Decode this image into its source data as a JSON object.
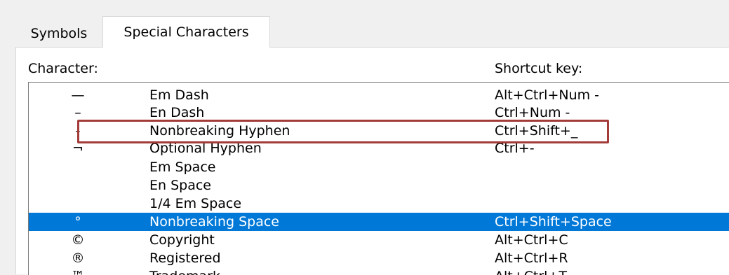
{
  "tabs": [
    {
      "label": "Symbols",
      "active": false
    },
    {
      "label": "Special Characters",
      "active": true
    }
  ],
  "headers": {
    "character": "Character:",
    "shortcut": "Shortcut key:"
  },
  "rows": [
    {
      "glyph": "—",
      "name": "Em Dash",
      "shortcut": "Alt+Ctrl+Num -"
    },
    {
      "glyph": "–",
      "name": "En Dash",
      "shortcut": "Ctrl+Num -"
    },
    {
      "glyph": "-",
      "name": "Nonbreaking Hyphen",
      "shortcut": "Ctrl+Shift+_"
    },
    {
      "glyph": "¬",
      "name": "Optional Hyphen",
      "shortcut": "Ctrl+-"
    },
    {
      "glyph": "",
      "name": "Em Space",
      "shortcut": ""
    },
    {
      "glyph": "",
      "name": "En Space",
      "shortcut": ""
    },
    {
      "glyph": "",
      "name": "1/4 Em Space",
      "shortcut": ""
    },
    {
      "glyph": "°",
      "name": "Nonbreaking Space",
      "shortcut": "Ctrl+Shift+Space"
    },
    {
      "glyph": "©",
      "name": "Copyright",
      "shortcut": "Alt+Ctrl+C"
    },
    {
      "glyph": "®",
      "name": "Registered",
      "shortcut": "Alt+Ctrl+R"
    },
    {
      "glyph": "™",
      "name": "Trademark",
      "shortcut": "Alt+Ctrl+T"
    }
  ],
  "selected_row": "Nonbreaking Space",
  "colors": {
    "selection": "#0078d7",
    "highlight_box": "#a33b39"
  }
}
